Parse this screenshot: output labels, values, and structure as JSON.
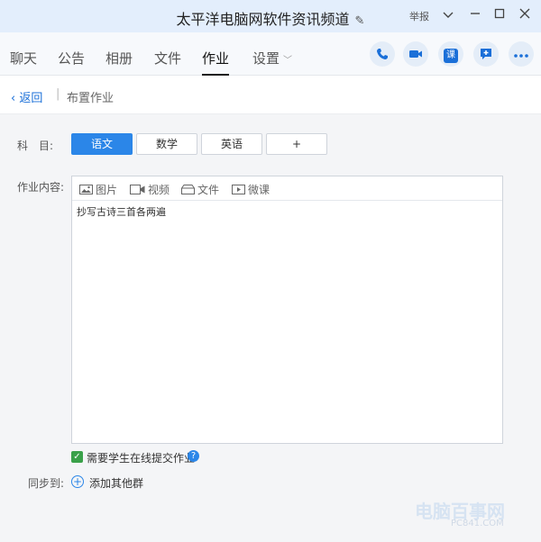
{
  "window": {
    "title": "太平洋电脑网软件资讯频道",
    "report_label": "举报",
    "controls": [
      "chevron-down-icon",
      "minimize-icon",
      "maximize-icon",
      "close-icon"
    ]
  },
  "tabs": [
    {
      "label": "聊天",
      "active": false
    },
    {
      "label": "公告",
      "active": false
    },
    {
      "label": "相册",
      "active": false
    },
    {
      "label": "文件",
      "active": false
    },
    {
      "label": "作业",
      "active": true
    },
    {
      "label": "设置",
      "active": false
    }
  ],
  "toolbar_buttons": {
    "phone_icon": "phone-icon",
    "video_icon": "video-call-icon",
    "class_label": "课",
    "add_chat_icon": "add-chat-icon",
    "more_icon": "more-icon"
  },
  "breadcrumb": {
    "back_label": "返回",
    "separator": "|",
    "current": "布置作业"
  },
  "form": {
    "subject_label": "科　目:",
    "subjects": [
      {
        "label": "语文",
        "active": true
      },
      {
        "label": "数学",
        "active": false
      },
      {
        "label": "英语",
        "active": false
      },
      {
        "label": "+",
        "active": false
      }
    ],
    "content_label": "作业内容:",
    "editor_tools": [
      {
        "icon": "image-icon",
        "label": "图片"
      },
      {
        "icon": "video-icon",
        "label": "视频"
      },
      {
        "icon": "folder-icon",
        "label": "文件"
      },
      {
        "icon": "play-icon",
        "label": "微课"
      }
    ],
    "content_value": "抄写古诗三首各两遍",
    "require_online_label": "需要学生在线提交作业",
    "require_online_checked": true,
    "sync_label": "同步到:",
    "add_group_label": "添加其他群"
  },
  "watermark": {
    "line1": "电脑百事网",
    "line2": "PC841.COM"
  },
  "colors": {
    "accent": "#2b86e8",
    "check_green": "#3aa14a",
    "titlebar_bg": "#e3eefc"
  }
}
